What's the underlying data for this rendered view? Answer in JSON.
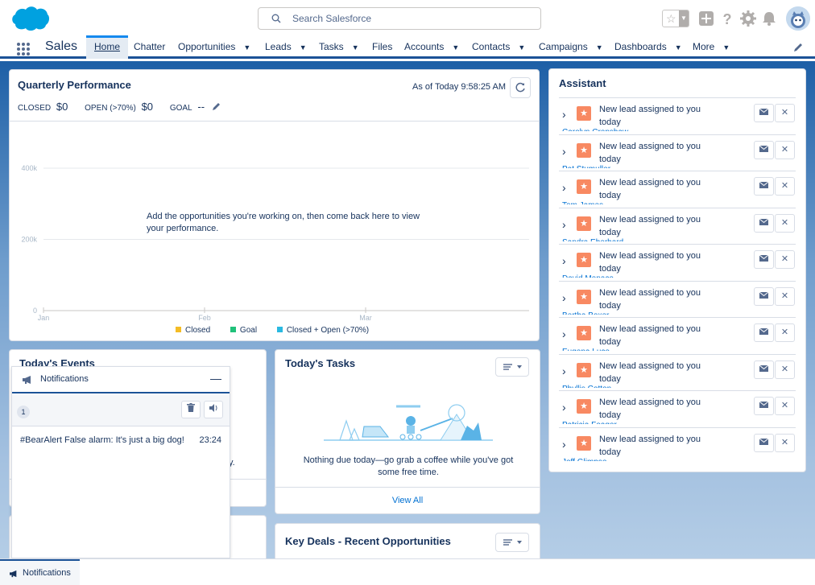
{
  "header": {
    "search_placeholder": "Search Salesforce"
  },
  "nav": {
    "app_name": "Sales",
    "items": [
      {
        "label": "Home",
        "dropdown": false
      },
      {
        "label": "Chatter",
        "dropdown": false
      },
      {
        "label": "Opportunities",
        "dropdown": true
      },
      {
        "label": "Leads",
        "dropdown": true
      },
      {
        "label": "Tasks",
        "dropdown": true
      },
      {
        "label": "Files",
        "dropdown": false
      },
      {
        "label": "Accounts",
        "dropdown": true
      },
      {
        "label": "Contacts",
        "dropdown": true
      },
      {
        "label": "Campaigns",
        "dropdown": true
      },
      {
        "label": "Dashboards",
        "dropdown": true
      },
      {
        "label": "More",
        "dropdown": true
      }
    ]
  },
  "quarterly": {
    "title": "Quarterly Performance",
    "as_of": "As of Today 9:58:25 AM",
    "closed_label": "CLOSED",
    "closed_value": "$0",
    "open_label": "OPEN (>70%)",
    "open_value": "$0",
    "goal_label": "GOAL",
    "goal_value": "--",
    "empty_message": "Add the opportunities you're working on, then come back here to view your performance.",
    "legend": [
      {
        "label": "Closed",
        "color": "#f4bc25"
      },
      {
        "label": "Goal",
        "color": "#20c17a"
      },
      {
        "label": "Closed + Open (>70%)",
        "color": "#2ab9e1"
      }
    ]
  },
  "chart_data": {
    "type": "line",
    "categories": [
      "Jan",
      "Feb",
      "Mar"
    ],
    "y_ticks": [
      "400k",
      "200k",
      "0"
    ],
    "ylim": [
      0,
      400000
    ],
    "series": []
  },
  "assistant": {
    "title": "Assistant",
    "items": [
      {
        "text": "New lead assigned to you today",
        "name": "Carolyn Crenshaw"
      },
      {
        "text": "New lead assigned to you today",
        "name": "Pat Stumuller"
      },
      {
        "text": "New lead assigned to you today",
        "name": "Tom James"
      },
      {
        "text": "New lead assigned to you today",
        "name": "Sandra Eberhard"
      },
      {
        "text": "New lead assigned to you today",
        "name": "David Monaco"
      },
      {
        "text": "New lead assigned to you today",
        "name": "Bertha Boxer"
      },
      {
        "text": "New lead assigned to you today",
        "name": "Eugena Luce"
      },
      {
        "text": "New lead assigned to you today",
        "name": "Phyllis Cotton"
      },
      {
        "text": "New lead assigned to you today",
        "name": "Patricia Feager"
      },
      {
        "text": "New lead assigned to you today",
        "name": "Jeff Glimpse"
      }
    ]
  },
  "events": {
    "title": "Today's Events",
    "partial_text": "y."
  },
  "tasks": {
    "title": "Today's Tasks",
    "empty_message": "Nothing due today—go grab a coffee while you've got some free time.",
    "view_all": "View All"
  },
  "deals": {
    "title": "Key Deals - Recent Opportunities"
  },
  "notifications": {
    "title": "Notifications",
    "count": "1",
    "message": "#BearAlert False alarm: It's just a big dog!",
    "time": "23:24"
  },
  "utility_bar": {
    "label": "Notifications"
  }
}
